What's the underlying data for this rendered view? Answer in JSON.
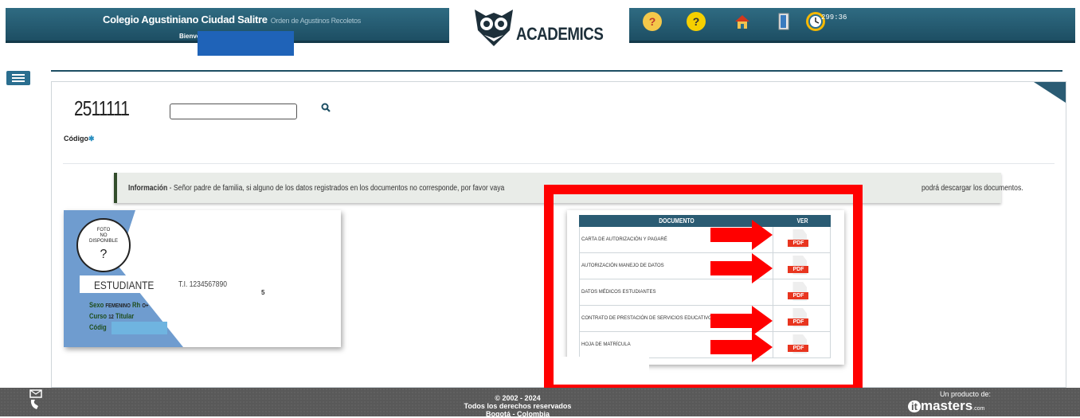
{
  "header": {
    "school_name": "Colegio Agustiniano Ciudad Salitre",
    "school_sub": "Orden de Agustinos Recoletos",
    "welcome": "Bienvenido",
    "logo_text": "ACADEMICS",
    "timer": "299:36",
    "icons": [
      "help-phone-icon",
      "question-icon",
      "home-icon",
      "exit-door-icon",
      "clock-icon"
    ]
  },
  "search": {
    "code_display": "2511111",
    "input_value": "",
    "code_label": "Código",
    "required_mark": "✱"
  },
  "info": {
    "title": "Información",
    "text": " - Señor padre de familia, si alguno de los datos registrados en los documentos no corresponde, por favor vaya",
    "text_end": "podrá descargar los documentos."
  },
  "student": {
    "photo_text": "FOTO\nNO\nDISPONIBLE",
    "photo_placeholder": "?",
    "name": "ESTUDIANTE",
    "id": "T.I. 1234567890",
    "extra": "5",
    "sex_label": "Sexo",
    "sex_value": "FEMENINO",
    "rh_label": "Rh",
    "rh_value": "O+",
    "course_label": "Curso",
    "course_value": "12",
    "titular_label": "Titular",
    "code_label": "Códig"
  },
  "documents": {
    "col_document": "DOCUMENTO",
    "col_view": "VER",
    "pdf_label": "PDF",
    "rows": [
      "CARTA DE AUTORIZACIÓN Y PAGARÉ",
      "AUTORIZACIÓN MANEJO DE DATOS",
      "DATOS MÉDICOS ESTUDIANTES",
      "CONTRATO DE PRESTACIÓN DE SERVICIOS EDUCATIVOS",
      "HOJA DE MATRÍCULA"
    ]
  },
  "footer": {
    "line1": "© 2002 - 2024",
    "line2": "Todos los derechos reservados",
    "line3": "Bogotá - Colombia",
    "product_of": "Un producto de:",
    "brand_main": "masters",
    "brand_com": ".com",
    "brand_mark": "it"
  },
  "colors": {
    "header_blue": "#1d4e63",
    "highlight_red": "#ff0000",
    "pdf_red": "#e8351f"
  }
}
